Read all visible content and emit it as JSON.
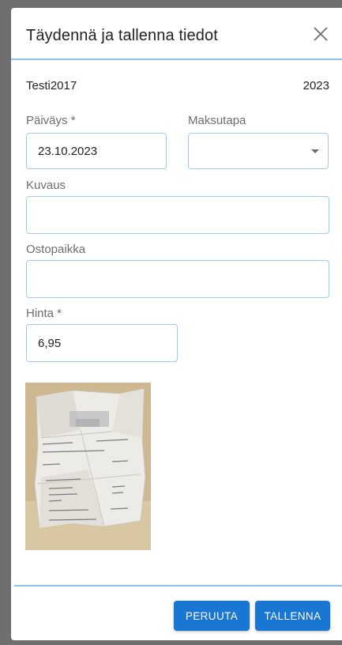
{
  "dialog": {
    "title": "Täydennä ja tallenna tiedot",
    "close_icon": "close-icon"
  },
  "meta": {
    "name": "Testi2017",
    "year": "2023"
  },
  "form": {
    "date": {
      "label": "Päiväys *",
      "value": "23.10.2023"
    },
    "payment_method": {
      "label": "Maksutapa",
      "value": ""
    },
    "description": {
      "label": "Kuvaus",
      "value": ""
    },
    "store": {
      "label": "Ostopaikka",
      "value": ""
    },
    "price": {
      "label": "Hinta *",
      "value": "6,95"
    }
  },
  "attachment": {
    "receipt_image": "receipt-thumbnail"
  },
  "buttons": {
    "cancel_label": "PERUUTA",
    "save_label": "TALLENNA"
  },
  "colors": {
    "accent": "#1976d2",
    "field_border": "#a7c8ea",
    "divider": "#8fc3ee"
  }
}
